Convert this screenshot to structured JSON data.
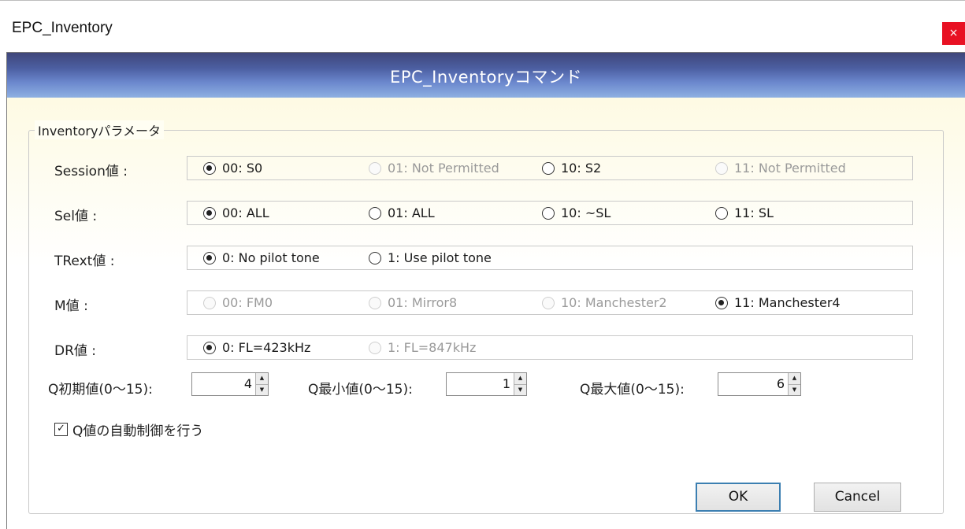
{
  "window": {
    "title": "EPC_Inventory",
    "close_label": "×"
  },
  "banner": {
    "title": "EPC_Inventoryコマンド"
  },
  "group": {
    "legend": "Inventoryパラメータ"
  },
  "rows": [
    {
      "label": "Session値 :",
      "options": [
        {
          "label": "00: S0",
          "selected": true,
          "enabled": true
        },
        {
          "label": "01: Not Permitted",
          "selected": false,
          "enabled": false
        },
        {
          "label": "10: S2",
          "selected": false,
          "enabled": true
        },
        {
          "label": "11: Not Permitted",
          "selected": false,
          "enabled": false
        }
      ]
    },
    {
      "label": "Sel値 :",
      "options": [
        {
          "label": "00: ALL",
          "selected": true,
          "enabled": true
        },
        {
          "label": "01: ALL",
          "selected": false,
          "enabled": true
        },
        {
          "label": "10: ~SL",
          "selected": false,
          "enabled": true
        },
        {
          "label": "11: SL",
          "selected": false,
          "enabled": true
        }
      ]
    },
    {
      "label": "TRext値 :",
      "options": [
        {
          "label": "0: No pilot tone",
          "selected": true,
          "enabled": true
        },
        {
          "label": "1: Use pilot tone",
          "selected": false,
          "enabled": true
        }
      ]
    },
    {
      "label": "M値 :",
      "options": [
        {
          "label": "00: FM0",
          "selected": false,
          "enabled": false
        },
        {
          "label": "01: Mirror8",
          "selected": false,
          "enabled": false
        },
        {
          "label": "10: Manchester2",
          "selected": false,
          "enabled": false
        },
        {
          "label": "11: Manchester4",
          "selected": true,
          "enabled": true
        }
      ]
    },
    {
      "label": "DR値 :",
      "options": [
        {
          "label": "0: FL=423kHz",
          "selected": true,
          "enabled": true
        },
        {
          "label": "1: FL=847kHz",
          "selected": false,
          "enabled": false
        }
      ]
    }
  ],
  "q": {
    "initial": {
      "label": "Q初期値(0〜15):",
      "value": "4"
    },
    "min": {
      "label": "Q最小値(0〜15):",
      "value": "1"
    },
    "max": {
      "label": "Q最大値(0〜15):",
      "value": "6"
    }
  },
  "auto_control": {
    "label": "Q値の自動制御を行う",
    "checked": true,
    "check_mark": "✓"
  },
  "buttons": {
    "ok": "OK",
    "cancel": "Cancel"
  }
}
